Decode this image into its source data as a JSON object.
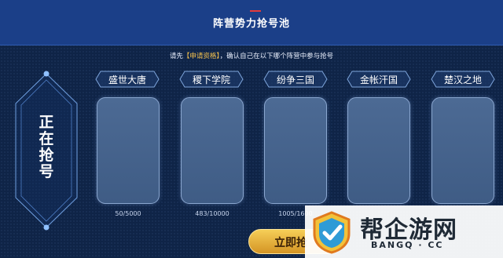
{
  "header": {
    "title": "阵营势力抢号池"
  },
  "instruction": {
    "prefix": "请先",
    "link": "【申请资格】",
    "suffix": "，确认自己在以下哪个阵营中参与抢号"
  },
  "side_panel": {
    "status_text": "正在抢号"
  },
  "factions": [
    {
      "name": "盛世大唐",
      "count": "50/5000"
    },
    {
      "name": "稷下学院",
      "count": "483/10000"
    },
    {
      "name": "纷争三国",
      "count": "1005/1600"
    },
    {
      "name": "金帐汗国",
      "count": ""
    },
    {
      "name": "楚汉之地",
      "count": ""
    }
  ],
  "grab_button": {
    "label": "立即抢"
  },
  "watermark": {
    "text": "帮企游网",
    "url": "BANGQ · CC"
  },
  "colors": {
    "background": "#0f2447",
    "header": "#1b3f88",
    "accent": "#e53b3b",
    "link": "#f3c04d",
    "button": "#e3ad3a"
  }
}
